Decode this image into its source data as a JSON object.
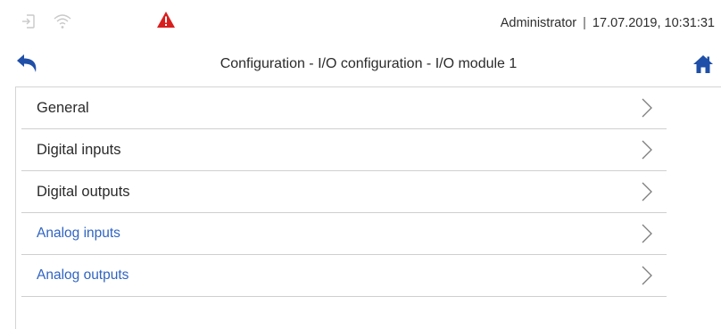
{
  "status": {
    "icons": [
      "login-icon",
      "wifi-icon",
      "warning-icon"
    ],
    "warning_color": "#d91e1e",
    "user": "Administrator",
    "separator": "|",
    "datetime": "17.07.2019, 10:31:31"
  },
  "header": {
    "title": "Configuration - I/O configuration - I/O module 1",
    "icons": [
      "back-arrow-icon",
      "home-icon"
    ],
    "accent_color": "#1f4fa8"
  },
  "menu": {
    "items": [
      {
        "label": "General"
      },
      {
        "label": "Digital inputs"
      },
      {
        "label": "Digital outputs"
      },
      {
        "label": "Analog inputs"
      },
      {
        "label": "Analog outputs"
      }
    ],
    "link_color": "#2f64c2"
  }
}
